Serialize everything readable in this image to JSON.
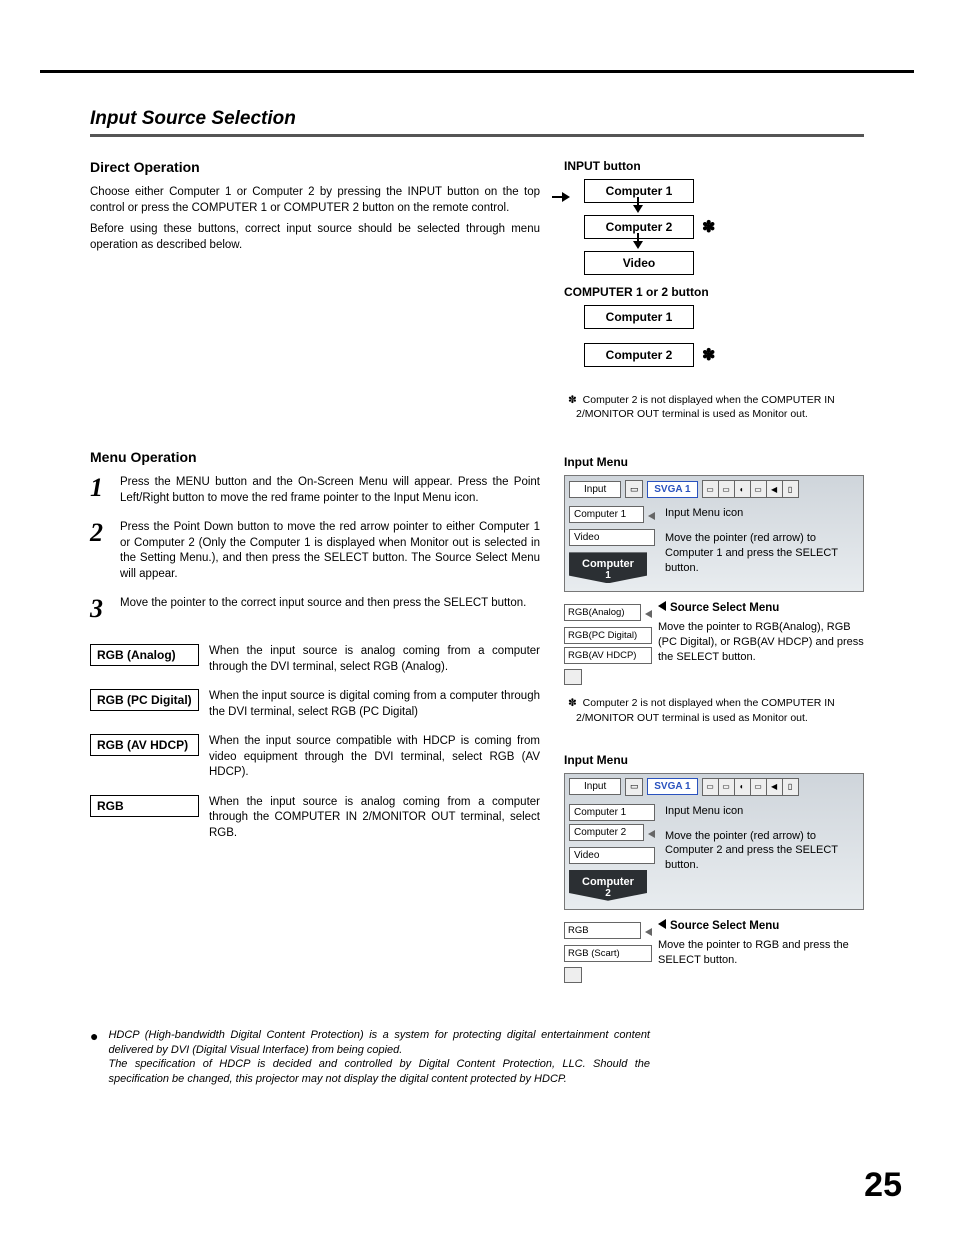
{
  "page": {
    "title": "Input Source Selection",
    "number": "25"
  },
  "direct": {
    "heading": "Direct Operation",
    "p1": "Choose either Computer 1 or Computer 2 by pressing the INPUT button on the top control or press the COMPUTER 1 or COMPUTER 2 button on the remote control.",
    "p2": "Before using these buttons, correct input source should be selected through menu operation as described below."
  },
  "menu": {
    "heading": "Menu Operation",
    "steps": [
      "Press the MENU button and the On-Screen Menu will appear. Press the Point Left/Right button to move the red frame pointer to the Input Menu icon.",
      "Press the Point Down button to move the red arrow pointer to either Computer 1 or Computer 2 (Only the Computer 1 is displayed when Monitor out is selected in the Setting Menu.), and then press the SELECT button. The Source Select Menu will appear.",
      "Move the pointer to the correct input source and then press the SELECT button."
    ],
    "rgb": [
      {
        "label": "RGB (Analog)",
        "body": "When the input source is analog coming from a computer through the DVI terminal, select RGB (Analog)."
      },
      {
        "label": "RGB (PC Digital)",
        "body": "When the input source is digital coming from a computer through the DVI terminal, select RGB (PC Digital)"
      },
      {
        "label": "RGB (AV HDCP)",
        "body": "When the input source compatible with HDCP is coming from video equipment through the DVI terminal, select RGB (AV HDCP)."
      },
      {
        "label": "RGB",
        "body": "When the input source is analog coming from a computer through the COMPUTER IN 2/MONITOR OUT terminal, select RGB."
      }
    ]
  },
  "diagram": {
    "input_button": "INPUT button",
    "computer1": "Computer 1",
    "computer2": "Computer 2",
    "video": "Video",
    "comp_button": "COMPUTER 1 or 2 button",
    "note": "Computer 2 is not displayed when the COMPUTER IN 2/MONITOR OUT terminal is used as Monitor out.",
    "asterisk": "✽"
  },
  "inputmenu": {
    "heading": "Input Menu",
    "tab_input": "Input",
    "signal": "SVGA 1",
    "icon_label": "Input Menu icon",
    "items1": [
      "Computer 1",
      "Video"
    ],
    "items2": [
      "Computer 1",
      "Computer 2",
      "Video"
    ],
    "move1": "Move the pointer (red arrow) to Computer 1 and press the SELECT button.",
    "move2": "Move the pointer (red arrow) to Computer 2 and press the SELECT button.",
    "ssm": "Source Select Menu",
    "ssm_note1": "Move the pointer to RGB(Analog), RGB (PC Digital), or RGB(AV HDCP) and press the SELECT button.",
    "ssm_note2": "Move the pointer to RGB and press the SELECT button.",
    "comp_badge1": "Computer",
    "comp_badge1n": "1",
    "comp_badge2n": "2",
    "src1": [
      "RGB(Analog)",
      "RGB(PC Digital)",
      "RGB(AV HDCP)"
    ],
    "src2": [
      "RGB",
      "RGB (Scart)"
    ],
    "ast_note": "Computer 2 is not displayed when the COMPUTER IN 2/MONITOR OUT terminal is used as Monitor out."
  },
  "footnote": {
    "p1": "HDCP (High-bandwidth Digital Content Protection) is a system for protecting digital entertainment content delivered by DVI (Digital Visual Interface) from being copied.",
    "p2": "The specification of HDCP is decided and controlled by Digital Content Protection, LLC. Should the specification be changed, this projector may not display the digital content protected by HDCP."
  }
}
